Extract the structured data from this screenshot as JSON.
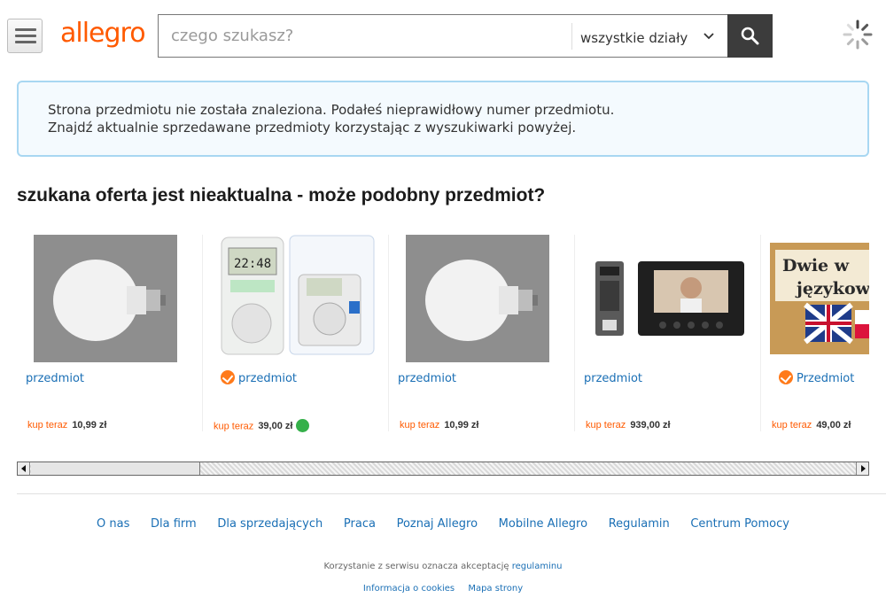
{
  "colors": {
    "brand": "#ff5a00",
    "link": "#1a6fb5",
    "notice_border": "#a8d7f2",
    "search_button": "#3c3c3c"
  },
  "header": {
    "logo": "allegro",
    "search_placeholder": "czego szukasz?",
    "category": "wszystkie działy"
  },
  "notice": {
    "line1": "Strona przedmiotu nie została znaleziona. Podałeś nieprawidłowy numer przedmiotu.",
    "line2": "Znajdź aktualnie sprzedawane przedmioty korzystając z wyszukiwarki powyżej."
  },
  "section_title": "szukana oferta jest nieaktualna - może podobny przedmiot?",
  "items": [
    {
      "title": "przedmiot",
      "price_label": "kup teraz",
      "price": "10,99 zł",
      "badge": false,
      "icon": "led-bulb-image"
    },
    {
      "title": "przedmiot",
      "price_label": "kup teraz",
      "price": "39,00 zł",
      "badge": true,
      "icon": "digital-timer-socket-image"
    },
    {
      "title": "przedmiot",
      "price_label": "kup teraz",
      "price": "10,99 zł",
      "badge": false,
      "icon": "led-bulb-image"
    },
    {
      "title": "przedmiot",
      "price_label": "kup teraz",
      "price": "939,00 zł",
      "badge": false,
      "icon": "video-intercom-image"
    },
    {
      "title": "Przedmiot",
      "price_label": "kup teraz",
      "price": "49,00 zł",
      "badge": true,
      "icon": "language-poster-image",
      "image_text": [
        "Dwie w",
        "językow"
      ]
    }
  ],
  "footer": {
    "links": [
      "O nas",
      "Dla firm",
      "Dla sprzedających",
      "Praca",
      "Poznaj Allegro",
      "Mobilne Allegro",
      "Regulamin",
      "Centrum Pomocy"
    ],
    "note": "Korzystanie z serwisu oznacza akceptację",
    "note_link": "regulaminu",
    "bottom_links": [
      "Informacja o cookies",
      "Mapa strony"
    ]
  }
}
